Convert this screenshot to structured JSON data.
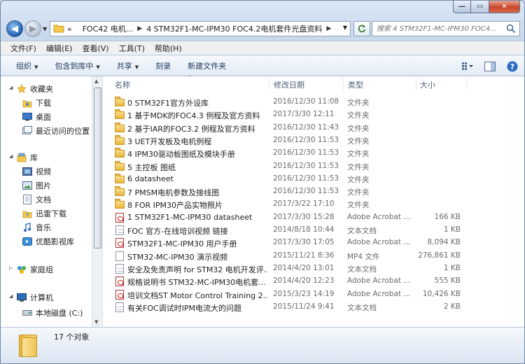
{
  "address": {
    "overflow": "«",
    "crumbs": [
      "FOC42 电机...",
      "4 STM32F1-MC-IPM30 FOC4.2电机套件光盘资料"
    ]
  },
  "search": {
    "placeholder": "搜索 4 STM32F1-MC-IPM30 FOC4..."
  },
  "menu": [
    "文件(F)",
    "编辑(E)",
    "查看(V)",
    "工具(T)",
    "帮助(H)"
  ],
  "toolbar": {
    "organize": "组织",
    "include": "包含到库中",
    "share": "共享",
    "burn": "刻录",
    "new_folder": "新建文件夹"
  },
  "nav": {
    "favorites": "收藏夹",
    "downloads": "下载",
    "desktop": "桌面",
    "recent": "最近访问的位置",
    "libraries": "库",
    "video": "视频",
    "pictures": "图片",
    "documents": "文档",
    "thunder": "迅雷下载",
    "music": "音乐",
    "youku": "优酷影视库",
    "homegroup": "家庭组",
    "computer": "计算机",
    "local_disk": "本地磁盘 (C:)"
  },
  "columns": {
    "name": "名称",
    "date": "修改日期",
    "type": "类型",
    "size": "大小"
  },
  "files": [
    {
      "icon": "folder",
      "name": "0 STM32F1官方外设库",
      "date": "2016/12/30 11:08",
      "type": "文件夹",
      "size": ""
    },
    {
      "icon": "folder",
      "name": "1 基于MDK的FOC4.3 例程及官方资料",
      "date": "2017/3/30 12:11",
      "type": "文件夹",
      "size": ""
    },
    {
      "icon": "folder",
      "name": "2 基于IAR的FOC3.2 例程及官方资料",
      "date": "2016/12/30 11:43",
      "type": "文件夹",
      "size": ""
    },
    {
      "icon": "folder",
      "name": "3 UET开发板及电机例程",
      "date": "2016/12/30 11:53",
      "type": "文件夹",
      "size": ""
    },
    {
      "icon": "folder",
      "name": "4 IPM30驱动板图纸及模块手册",
      "date": "2016/12/30 11:53",
      "type": "文件夹",
      "size": ""
    },
    {
      "icon": "folder",
      "name": "5 主控板 图纸",
      "date": "2016/12/30 11:53",
      "type": "文件夹",
      "size": ""
    },
    {
      "icon": "folder",
      "name": "6 datasheet",
      "date": "2016/12/30 11:53",
      "type": "文件夹",
      "size": ""
    },
    {
      "icon": "folder",
      "name": "7 PMSM电机参数及接线图",
      "date": "2016/12/30 11:53",
      "type": "文件夹",
      "size": ""
    },
    {
      "icon": "folder",
      "name": "8 FOR IPM30产品实物照片",
      "date": "2017/3/22 17:10",
      "type": "文件夹",
      "size": ""
    },
    {
      "icon": "pdf",
      "name": "1 STM32F1-MC-IPM30 datasheet",
      "date": "2017/3/30 15:28",
      "type": "Adobe Acrobat ...",
      "size": "166 KB"
    },
    {
      "icon": "txt",
      "name": "FOC 官方-在线培训视频 链接",
      "date": "2014/8/18 10:44",
      "type": "文本文档",
      "size": "1 KB"
    },
    {
      "icon": "pdf",
      "name": "STM32F1-MC-IPM30 用户手册",
      "date": "2017/3/30 17:05",
      "type": "Adobe Acrobat ...",
      "size": "8,094 KB"
    },
    {
      "icon": "mp4",
      "name": "STM32-MC-IPM30 演示视频",
      "date": "2015/11/21 8:36",
      "type": "MP4 文件",
      "size": "276,861 KB"
    },
    {
      "icon": "txt",
      "name": "安全及免责声明 for STM32 电机开发评...",
      "date": "2014/4/20 13:01",
      "type": "文本文档",
      "size": "1 KB"
    },
    {
      "icon": "pdf",
      "name": "规格说明书 STM32-MC-IPM30电机套...",
      "date": "2014/4/20 12:23",
      "type": "Adobe Acrobat ...",
      "size": "555 KB"
    },
    {
      "icon": "pdf",
      "name": "培训文档ST Motor Control Training 2...",
      "date": "2015/3/23 14:19",
      "type": "Adobe Acrobat ...",
      "size": "10,426 KB"
    },
    {
      "icon": "txt",
      "name": "有关FOC调试时IPM电流大的问题",
      "date": "2015/11/24 9:41",
      "type": "文本文档",
      "size": "2 KB"
    }
  ],
  "status": {
    "count": "17 个对象"
  }
}
